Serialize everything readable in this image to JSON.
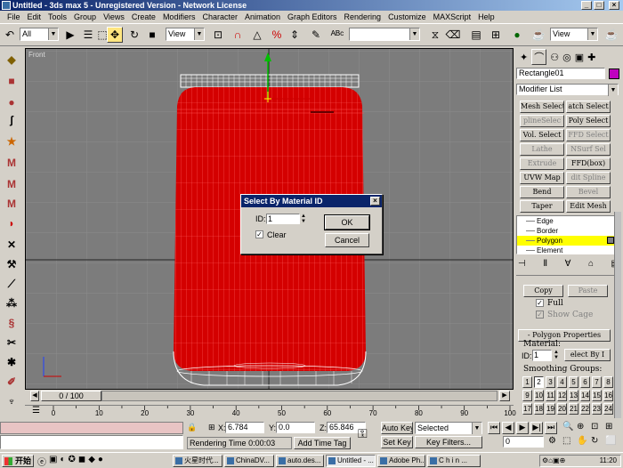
{
  "window": {
    "title": "Untitled - 3ds max 5 - Unregistered Version - Network License",
    "minimize": "_",
    "maximize": "□",
    "close": "×"
  },
  "menu": [
    "File",
    "Edit",
    "Tools",
    "Group",
    "Views",
    "Create",
    "Modifiers",
    "Character",
    "Animation",
    "Graph Editors",
    "Rendering",
    "Customize",
    "MAXScript",
    "Help"
  ],
  "toolbar": {
    "selection_filter": "All",
    "ref_coord": "View",
    "named_selection": "",
    "view_dropdown": "View"
  },
  "viewport": {
    "label": "Front",
    "background": "#7c7c7c",
    "mesh_color": "#dd0000"
  },
  "dialog": {
    "title": "Select By Material ID",
    "id_label": "ID:",
    "id_value": "1",
    "ok": "OK",
    "cancel": "Cancel",
    "clear_label": "Clear",
    "clear_checked": true
  },
  "panel": {
    "object_name": "Rectangle01",
    "object_color": "#c000c0",
    "modifier_list": "Modifier List",
    "modifier_buttons": [
      {
        "label": "Mesh Select",
        "enabled": true
      },
      {
        "label": "atch Select",
        "enabled": true
      },
      {
        "label": "plineSelec",
        "enabled": false
      },
      {
        "label": "Poly Select",
        "enabled": true
      },
      {
        "label": "Vol. Select",
        "enabled": true
      },
      {
        "label": "FFD Select",
        "enabled": false
      },
      {
        "label": "Lathe",
        "enabled": false
      },
      {
        "label": "NSurf Sel",
        "enabled": false
      },
      {
        "label": "Extrude",
        "enabled": false
      },
      {
        "label": "FFD(box)",
        "enabled": true
      },
      {
        "label": "UVW Map",
        "enabled": true
      },
      {
        "label": "dit Spline",
        "enabled": false
      },
      {
        "label": "Bend",
        "enabled": true
      },
      {
        "label": "Bevel",
        "enabled": false
      },
      {
        "label": "Taper",
        "enabled": true
      },
      {
        "label": "Edit Mesh",
        "enabled": true
      }
    ],
    "stack_items": [
      "Edge",
      "Border",
      "Polygon",
      "Element"
    ],
    "stack_selected": "Polygon",
    "copy": "Copy",
    "paste": "Paste",
    "full_label": "Full",
    "show_cage_label": "Show Cage",
    "rollout_title": "- Polygon Properties",
    "material_label": "Material:",
    "mat_id_label": "ID:",
    "mat_id_value": "1",
    "select_by_id": "elect By I",
    "smoothing_label": "Smoothing Groups:",
    "smoothing_groups": [
      "1",
      "2",
      "3",
      "4",
      "5",
      "6",
      "7",
      "8",
      "9",
      "10",
      "11",
      "12",
      "13",
      "14",
      "15",
      "16",
      "17",
      "18",
      "19",
      "20",
      "21",
      "22",
      "23",
      "24"
    ],
    "smoothing_pressed": "2"
  },
  "timeline": {
    "frame": "0 / 100",
    "ticks": [
      "0",
      "10",
      "20",
      "30",
      "40",
      "50",
      "60",
      "70",
      "80",
      "90",
      "100"
    ]
  },
  "status": {
    "x_label": "X:",
    "x_value": "6.784",
    "y_label": "Y:",
    "y_value": "0.0",
    "z_label": "Z:",
    "z_value": "65.846",
    "render_time_label": "Rendering Time",
    "render_time": "0:00:03",
    "add_time_tag": "Add Time Tag",
    "auto_key": "Auto Key",
    "set_key": "Set Key",
    "key_mode": "Selected",
    "key_filters": "Key Filters...",
    "frame_field": "0"
  },
  "taskbar": {
    "start": "开始",
    "tasks": [
      "火星时代...",
      "ChinaDV...",
      "auto.des...",
      "Untitled - ...",
      "Adobe Ph...",
      "C h i n ..."
    ],
    "clock": "11:20"
  }
}
